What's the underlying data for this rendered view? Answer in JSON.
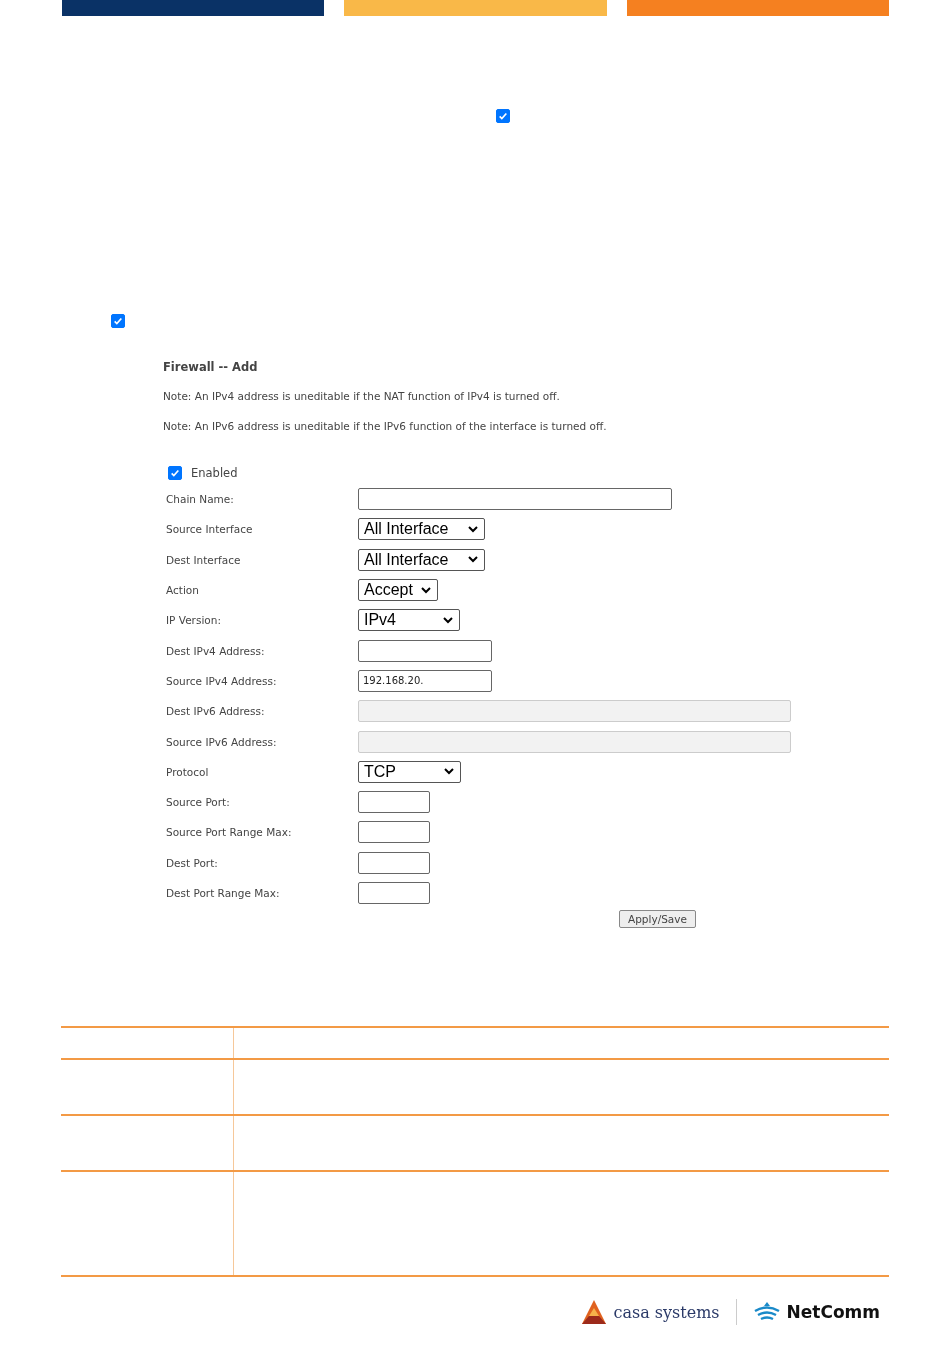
{
  "loose_checkboxes": [
    {
      "checked": true
    },
    {
      "checked": true
    }
  ],
  "form": {
    "title": "Firewall -- Add",
    "notes": [
      "Note: An IPv4 address is uneditable if the NAT function of IPv4 is turned off.",
      "Note: An IPv6 address is uneditable if the IPv6 function of the interface is turned off."
    ],
    "enabled": {
      "label": "Enabled",
      "checked": true
    },
    "fields": [
      {
        "label": "Chain Name:",
        "kind": "text",
        "disabled": false
      },
      {
        "label": "Source Interface",
        "kind": "select",
        "value": "All Interface"
      },
      {
        "label": "Dest Interface",
        "kind": "select",
        "value": "All Interface"
      },
      {
        "label": "Action",
        "kind": "select",
        "value": "Accept"
      },
      {
        "label": "IP Version:",
        "kind": "select",
        "value": "IPv4"
      },
      {
        "label": "Dest IPv4 Address:",
        "kind": "text",
        "disabled": false
      },
      {
        "label": "Source IPv4 Address:",
        "kind": "text",
        "disabled": false,
        "value": "192.168.20."
      },
      {
        "label": "Dest IPv6 Address:",
        "kind": "text",
        "disabled": true
      },
      {
        "label": "Source IPv6 Address:",
        "kind": "text",
        "disabled": true
      },
      {
        "label": "Protocol",
        "kind": "select",
        "value": "TCP"
      },
      {
        "label": "Source Port:",
        "kind": "text",
        "disabled": false
      },
      {
        "label": "Source Port Range Max:",
        "kind": "text",
        "disabled": false
      },
      {
        "label": "Dest Port:",
        "kind": "text",
        "disabled": false
      },
      {
        "label": "Dest Port Range Max:",
        "kind": "text",
        "disabled": false
      }
    ],
    "apply_button": "Apply/Save"
  },
  "footer": {
    "logos": [
      "casa systems",
      "NetComm"
    ]
  }
}
